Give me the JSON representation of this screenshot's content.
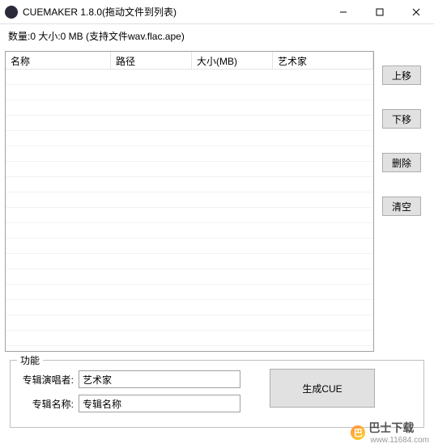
{
  "titlebar": {
    "title": "CUEMAKER 1.8.0(拖动文件到列表)"
  },
  "status": {
    "text": "数量:0 大小:0 MB  (支持文件wav.flac.ape)"
  },
  "table": {
    "headers": {
      "name": "名称",
      "path": "路径",
      "size": "大小(MB)",
      "artist": "艺术家"
    },
    "rows": []
  },
  "side_buttons": {
    "move_up": "上移",
    "move_down": "下移",
    "delete": "删除",
    "clear": "清空"
  },
  "functions": {
    "group_label": "功能",
    "artist_label": "专辑演唱者:",
    "artist_value": "艺术家",
    "album_label": "专辑名称:",
    "album_value": "专辑名称",
    "generate_label": "生成CUE"
  },
  "watermark": {
    "icon_text": "巴",
    "main": "巴士下载",
    "sub": "www.11684.com"
  }
}
